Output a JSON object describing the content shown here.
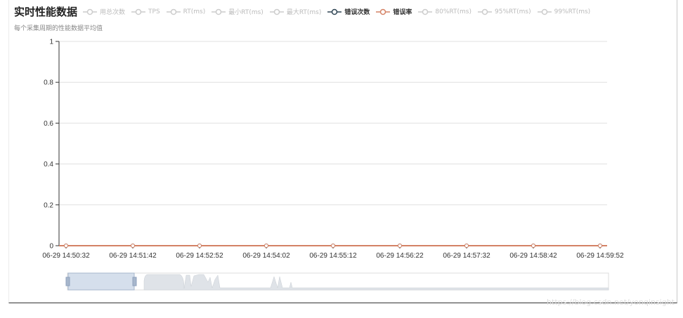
{
  "chart_data": {
    "type": "line",
    "title": "实时性能数据",
    "subtitle": "每个采集周期的性能数据平均值",
    "x": [
      "06-29 14:50:32",
      "06-29 14:51:42",
      "06-29 14:52:52",
      "06-29 14:54:02",
      "06-29 14:55:12",
      "06-29 14:56:22",
      "06-29 14:57:32",
      "06-29 14:58:42",
      "06-29 14:59:52"
    ],
    "ylim": [
      0,
      1
    ],
    "yticks": [
      "0",
      "0.2",
      "0.4",
      "0.6",
      "0.8",
      "1"
    ],
    "grid": true,
    "legend_position": "top",
    "legend": [
      {
        "name": "用总次数",
        "color": "#cccccc",
        "active": false
      },
      {
        "name": "TPS",
        "color": "#cccccc",
        "active": false
      },
      {
        "name": "RT(ms)",
        "color": "#cccccc",
        "active": false
      },
      {
        "name": "最小RT(ms)",
        "color": "#cccccc",
        "active": false
      },
      {
        "name": "最大RT(ms)",
        "color": "#cccccc",
        "active": false
      },
      {
        "name": "错误次数",
        "color": "#2f4554",
        "active": true
      },
      {
        "name": "错误率",
        "color": "#d48265",
        "active": true
      },
      {
        "name": "80%RT(ms)",
        "color": "#cccccc",
        "active": false
      },
      {
        "name": "95%RT(ms)",
        "color": "#cccccc",
        "active": false
      },
      {
        "name": "99%RT(ms)",
        "color": "#cccccc",
        "active": false
      }
    ],
    "series": [
      {
        "name": "错误次数",
        "color": "#2f4554",
        "values": [
          0,
          0,
          0,
          0,
          0,
          0,
          0,
          0,
          0
        ]
      },
      {
        "name": "错误率",
        "color": "#d48265",
        "values": [
          0,
          0,
          0,
          0,
          0,
          0,
          0,
          0,
          0
        ]
      }
    ]
  },
  "watermark": "https://blog.csdn.net/yonqinsight"
}
